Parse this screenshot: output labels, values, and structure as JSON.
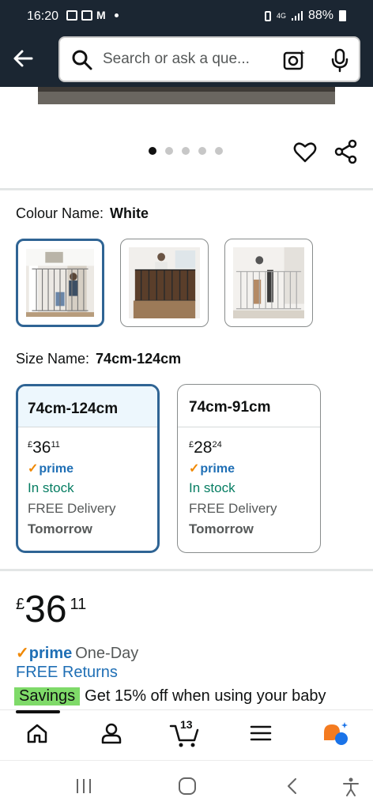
{
  "status_bar": {
    "time": "16:20",
    "network": "4G",
    "battery": "88%"
  },
  "search": {
    "placeholder": "Search or ask a que..."
  },
  "carousel": {
    "slide_count": 5,
    "active_index": 0
  },
  "colour": {
    "label": "Colour Name:",
    "value": "White",
    "swatch_count": 3,
    "selected_index": 0
  },
  "size": {
    "label": "Size Name:",
    "value": "74cm-124cm",
    "options": [
      {
        "name": "74cm-124cm",
        "currency": "£",
        "whole": "36",
        "fraction": "11",
        "prime": "prime",
        "stock": "In stock",
        "delivery": "FREE Delivery",
        "when": "Tomorrow",
        "selected": true
      },
      {
        "name": "74cm-91cm",
        "currency": "£",
        "whole": "28",
        "fraction": "24",
        "prime": "prime",
        "stock": "In stock",
        "delivery": "FREE Delivery",
        "when": "Tomorrow",
        "selected": false
      }
    ]
  },
  "price": {
    "currency": "£",
    "whole": "36",
    "fraction": "11"
  },
  "prime_line": {
    "prime": "prime",
    "one_day": "One-Day"
  },
  "returns": "FREE Returns",
  "savings": {
    "badge": "Savings",
    "text": "Get 15% off when using your baby"
  },
  "bottom_nav": {
    "cart_count": "13"
  },
  "colors": {
    "header_bg": "#1b2632",
    "selected_border": "#2f6494",
    "prime_blue": "#1f6fb5",
    "in_stock_green": "#067d62",
    "savings_green": "#7fda69"
  }
}
